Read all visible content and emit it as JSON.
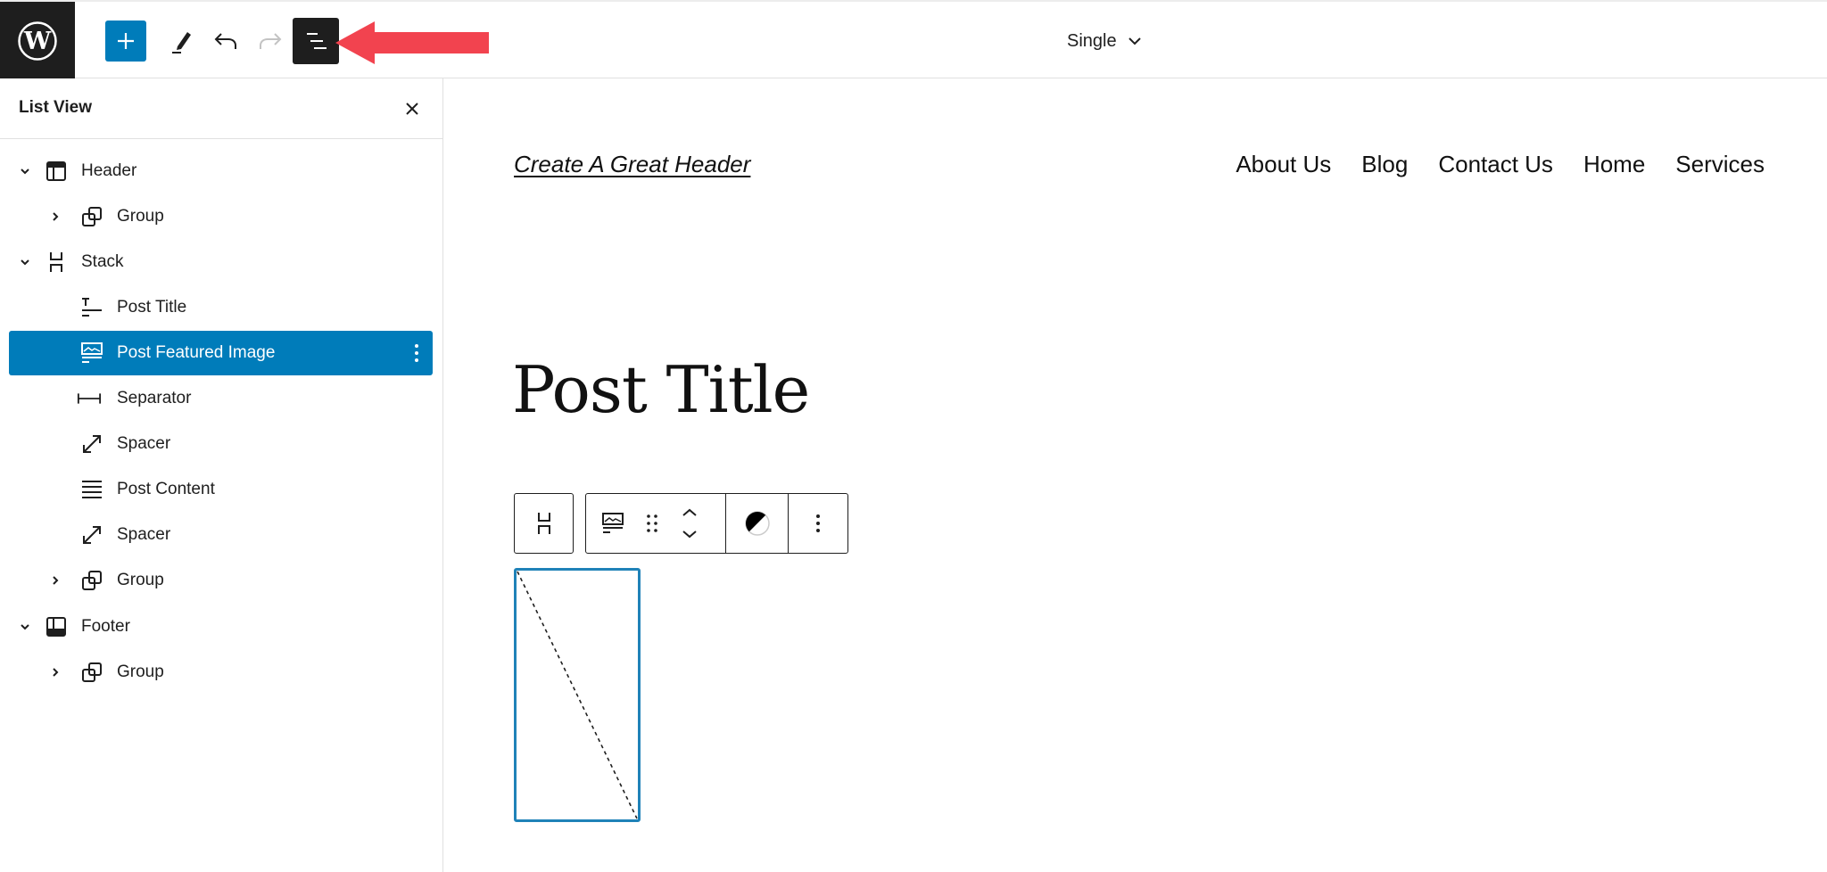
{
  "topbar": {
    "logo": "wordpress-logo",
    "inserter_icon": "plus-icon",
    "tools_icon": "pencil-icon",
    "undo_icon": "undo-icon",
    "redo_icon": "redo-icon",
    "list_view_icon": "list-view-icon",
    "annotation": "red-arrow-pointing-left",
    "document_switcher": {
      "label": "Single",
      "icon": "chevron-down-icon"
    }
  },
  "sidebar": {
    "title": "List View",
    "close_icon": "close-icon",
    "items": [
      {
        "label": "Header",
        "level": 1,
        "toggle": "expanded",
        "icon": "header-template-part-icon",
        "selected": false
      },
      {
        "label": "Group",
        "level": 2,
        "toggle": "collapsed",
        "icon": "group-icon",
        "selected": false
      },
      {
        "label": "Stack",
        "level": 1,
        "toggle": "expanded",
        "icon": "stack-icon",
        "selected": false
      },
      {
        "label": "Post Title",
        "level": 2,
        "toggle": "none",
        "icon": "post-title-icon",
        "selected": false
      },
      {
        "label": "Post Featured Image",
        "level": 2,
        "toggle": "none",
        "icon": "post-featured-image-icon",
        "selected": true
      },
      {
        "label": "Separator",
        "level": 2,
        "toggle": "none",
        "icon": "separator-icon",
        "selected": false
      },
      {
        "label": "Spacer",
        "level": 2,
        "toggle": "none",
        "icon": "spacer-icon",
        "selected": false
      },
      {
        "label": "Post Content",
        "level": 2,
        "toggle": "none",
        "icon": "post-content-icon",
        "selected": false
      },
      {
        "label": "Spacer",
        "level": 2,
        "toggle": "none",
        "icon": "spacer-icon",
        "selected": false
      },
      {
        "label": "Group",
        "level": 2,
        "toggle": "collapsed",
        "icon": "group-icon",
        "selected": false
      },
      {
        "label": "Footer",
        "level": 1,
        "toggle": "expanded",
        "icon": "footer-template-part-icon",
        "selected": false
      },
      {
        "label": "Group",
        "level": 2,
        "toggle": "collapsed",
        "icon": "group-icon",
        "selected": false
      }
    ]
  },
  "canvas": {
    "site_title": "Create A Great Header",
    "nav": [
      "About Us",
      "Blog",
      "Contact Us",
      "Home",
      "Services"
    ],
    "post_title": "Post Title",
    "block_toolbar": {
      "parent_icon": "stack-icon",
      "block_icon": "post-featured-image-icon",
      "drag_icon": "drag-handle-icon",
      "move_up_icon": "chevron-up-icon",
      "move_down_icon": "chevron-down-icon",
      "duotone_icon": "duotone-icon",
      "options_icon": "more-vertical-icon"
    },
    "featured_image": {
      "state": "placeholder"
    }
  },
  "colors": {
    "accent": "#007cba",
    "dark": "#1e1e1e",
    "annotation": "#f2434f",
    "selection_outline": "#1f82b8",
    "redo_disabled": "#c3c3c3"
  }
}
